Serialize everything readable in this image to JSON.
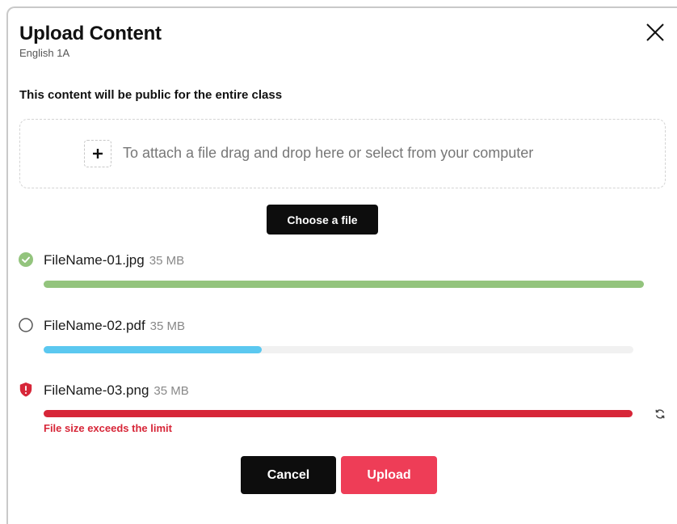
{
  "dialog": {
    "title": "Upload Content",
    "subtitle": "English 1A",
    "notice": "This content will be public for the entire class"
  },
  "dropzone": {
    "text": "To attach a file drag and drop here or select from your computer",
    "plus_icon": "plus-icon"
  },
  "choose_label": "Choose a file",
  "files": [
    {
      "name": "FileName-01.jpg",
      "size": "35 MB",
      "status": "complete",
      "progress": 1.0,
      "color": "#93c47d",
      "icon": "check-circle-icon"
    },
    {
      "name": "FileName-02.pdf",
      "size": "35 MB",
      "status": "uploading",
      "progress": 0.37,
      "color": "#5bc8f0",
      "icon": "circle-outline-icon"
    },
    {
      "name": "FileName-03.png",
      "size": "35 MB",
      "status": "error",
      "progress": 1.0,
      "color": "#d72638",
      "icon": "shield-alert-icon",
      "error": "File size exceeds the limit"
    }
  ],
  "buttons": {
    "cancel": "Cancel",
    "upload": "Upload"
  },
  "colors": {
    "accent": "#ee3d57",
    "dark": "#0d0d0d",
    "track": "#f1f1f1"
  }
}
